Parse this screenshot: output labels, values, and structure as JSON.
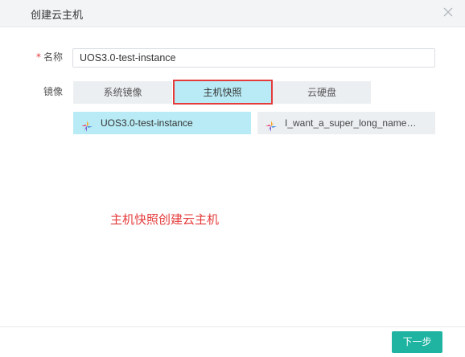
{
  "dialog": {
    "title": "创建云主机",
    "close_icon": "close-icon"
  },
  "form": {
    "name": {
      "label": "名称",
      "required_mark": "*",
      "value": "UOS3.0-test-instance"
    },
    "image": {
      "label": "镜像",
      "tabs": [
        {
          "label": "系统镜像",
          "active": false
        },
        {
          "label": "主机快照",
          "active": true
        },
        {
          "label": "云硬盘",
          "active": false
        }
      ],
      "snapshots": [
        {
          "label": "UOS3.0-test-instance",
          "selected": true,
          "icon": "snapshot-icon"
        },
        {
          "label": "I_want_a_super_long_name…",
          "selected": false,
          "icon": "snapshot-icon"
        }
      ]
    }
  },
  "annotation": "主机快照创建云主机",
  "footer": {
    "next_label": "下一步"
  },
  "colors": {
    "accent": "#1fb4a2",
    "selected_bg": "#b8ebf5",
    "highlight_red": "#e53b3b"
  }
}
